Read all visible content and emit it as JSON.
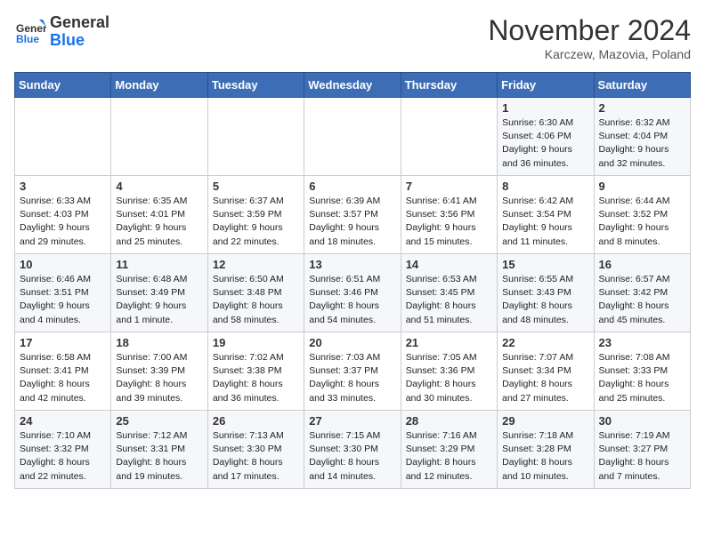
{
  "header": {
    "logo_line1": "General",
    "logo_line2": "Blue",
    "month": "November 2024",
    "location": "Karczew, Mazovia, Poland"
  },
  "days_of_week": [
    "Sunday",
    "Monday",
    "Tuesday",
    "Wednesday",
    "Thursday",
    "Friday",
    "Saturday"
  ],
  "weeks": [
    [
      {
        "day": "",
        "info": ""
      },
      {
        "day": "",
        "info": ""
      },
      {
        "day": "",
        "info": ""
      },
      {
        "day": "",
        "info": ""
      },
      {
        "day": "",
        "info": ""
      },
      {
        "day": "1",
        "info": "Sunrise: 6:30 AM\nSunset: 4:06 PM\nDaylight: 9 hours\nand 36 minutes."
      },
      {
        "day": "2",
        "info": "Sunrise: 6:32 AM\nSunset: 4:04 PM\nDaylight: 9 hours\nand 32 minutes."
      }
    ],
    [
      {
        "day": "3",
        "info": "Sunrise: 6:33 AM\nSunset: 4:03 PM\nDaylight: 9 hours\nand 29 minutes."
      },
      {
        "day": "4",
        "info": "Sunrise: 6:35 AM\nSunset: 4:01 PM\nDaylight: 9 hours\nand 25 minutes."
      },
      {
        "day": "5",
        "info": "Sunrise: 6:37 AM\nSunset: 3:59 PM\nDaylight: 9 hours\nand 22 minutes."
      },
      {
        "day": "6",
        "info": "Sunrise: 6:39 AM\nSunset: 3:57 PM\nDaylight: 9 hours\nand 18 minutes."
      },
      {
        "day": "7",
        "info": "Sunrise: 6:41 AM\nSunset: 3:56 PM\nDaylight: 9 hours\nand 15 minutes."
      },
      {
        "day": "8",
        "info": "Sunrise: 6:42 AM\nSunset: 3:54 PM\nDaylight: 9 hours\nand 11 minutes."
      },
      {
        "day": "9",
        "info": "Sunrise: 6:44 AM\nSunset: 3:52 PM\nDaylight: 9 hours\nand 8 minutes."
      }
    ],
    [
      {
        "day": "10",
        "info": "Sunrise: 6:46 AM\nSunset: 3:51 PM\nDaylight: 9 hours\nand 4 minutes."
      },
      {
        "day": "11",
        "info": "Sunrise: 6:48 AM\nSunset: 3:49 PM\nDaylight: 9 hours\nand 1 minute."
      },
      {
        "day": "12",
        "info": "Sunrise: 6:50 AM\nSunset: 3:48 PM\nDaylight: 8 hours\nand 58 minutes."
      },
      {
        "day": "13",
        "info": "Sunrise: 6:51 AM\nSunset: 3:46 PM\nDaylight: 8 hours\nand 54 minutes."
      },
      {
        "day": "14",
        "info": "Sunrise: 6:53 AM\nSunset: 3:45 PM\nDaylight: 8 hours\nand 51 minutes."
      },
      {
        "day": "15",
        "info": "Sunrise: 6:55 AM\nSunset: 3:43 PM\nDaylight: 8 hours\nand 48 minutes."
      },
      {
        "day": "16",
        "info": "Sunrise: 6:57 AM\nSunset: 3:42 PM\nDaylight: 8 hours\nand 45 minutes."
      }
    ],
    [
      {
        "day": "17",
        "info": "Sunrise: 6:58 AM\nSunset: 3:41 PM\nDaylight: 8 hours\nand 42 minutes."
      },
      {
        "day": "18",
        "info": "Sunrise: 7:00 AM\nSunset: 3:39 PM\nDaylight: 8 hours\nand 39 minutes."
      },
      {
        "day": "19",
        "info": "Sunrise: 7:02 AM\nSunset: 3:38 PM\nDaylight: 8 hours\nand 36 minutes."
      },
      {
        "day": "20",
        "info": "Sunrise: 7:03 AM\nSunset: 3:37 PM\nDaylight: 8 hours\nand 33 minutes."
      },
      {
        "day": "21",
        "info": "Sunrise: 7:05 AM\nSunset: 3:36 PM\nDaylight: 8 hours\nand 30 minutes."
      },
      {
        "day": "22",
        "info": "Sunrise: 7:07 AM\nSunset: 3:34 PM\nDaylight: 8 hours\nand 27 minutes."
      },
      {
        "day": "23",
        "info": "Sunrise: 7:08 AM\nSunset: 3:33 PM\nDaylight: 8 hours\nand 25 minutes."
      }
    ],
    [
      {
        "day": "24",
        "info": "Sunrise: 7:10 AM\nSunset: 3:32 PM\nDaylight: 8 hours\nand 22 minutes."
      },
      {
        "day": "25",
        "info": "Sunrise: 7:12 AM\nSunset: 3:31 PM\nDaylight: 8 hours\nand 19 minutes."
      },
      {
        "day": "26",
        "info": "Sunrise: 7:13 AM\nSunset: 3:30 PM\nDaylight: 8 hours\nand 17 minutes."
      },
      {
        "day": "27",
        "info": "Sunrise: 7:15 AM\nSunset: 3:30 PM\nDaylight: 8 hours\nand 14 minutes."
      },
      {
        "day": "28",
        "info": "Sunrise: 7:16 AM\nSunset: 3:29 PM\nDaylight: 8 hours\nand 12 minutes."
      },
      {
        "day": "29",
        "info": "Sunrise: 7:18 AM\nSunset: 3:28 PM\nDaylight: 8 hours\nand 10 minutes."
      },
      {
        "day": "30",
        "info": "Sunrise: 7:19 AM\nSunset: 3:27 PM\nDaylight: 8 hours\nand 7 minutes."
      }
    ]
  ]
}
